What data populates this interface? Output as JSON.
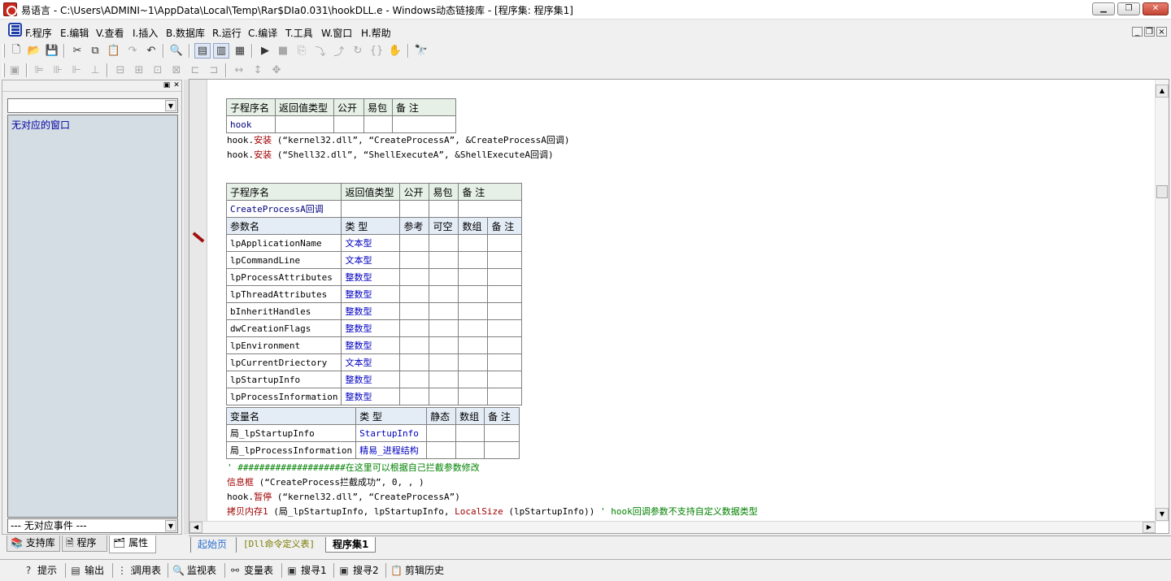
{
  "window": {
    "title": "易语言 - C:\\Users\\ADMINI~1\\AppData\\Local\\Temp\\Rar$DIa0.031\\hookDLL.e - Windows动态链接库 - [程序集: 程序集1]",
    "min": "▁",
    "restore": "❐",
    "close": "✕"
  },
  "menu": [
    "F.程序",
    "E.编辑",
    "V.查看",
    "I.插入",
    "B.数据库",
    "R.运行",
    "C.编译",
    "T.工具",
    "W.窗口",
    "H.帮助"
  ],
  "left_panel": {
    "top_combo": "",
    "list_item": "无对应的窗口",
    "bottom_combo": "--- 无对应事件 ---",
    "tabs": [
      "支持库",
      "程序",
      "属性"
    ]
  },
  "code": {
    "t1": {
      "headers": [
        "子程序名",
        "返回值类型",
        "公开",
        "易包",
        "备 注"
      ],
      "row": [
        "hook",
        "",
        "",
        "",
        ""
      ]
    },
    "line1": {
      "obj": "hook.",
      "fn": "安装",
      "args": " (“kernel32.dll”, “CreateProcessA”, &CreateProcessA回调)"
    },
    "line2": {
      "obj": "hook.",
      "fn": "安装",
      "args": " (“Shell32.dll”, “ShellExecuteA”, &ShellExecuteA回调)"
    },
    "t2": {
      "headers": [
        "子程序名",
        "返回值类型",
        "公开",
        "易包",
        "备 注"
      ],
      "sub_name": "CreateProcessA回调",
      "param_headers": [
        "参数名",
        "类 型",
        "参考",
        "可空",
        "数组",
        "备 注"
      ],
      "params": [
        [
          "lpApplicationName",
          "文本型"
        ],
        [
          "lpCommandLine",
          "文本型"
        ],
        [
          "lpProcessAttributes",
          "整数型"
        ],
        [
          "lpThreadAttributes",
          "整数型"
        ],
        [
          "bInheritHandles",
          "整数型"
        ],
        [
          "dwCreationFlags",
          "整数型"
        ],
        [
          "lpEnvironment",
          "整数型"
        ],
        [
          "lpCurrentDriectory",
          "文本型"
        ],
        [
          "lpStartupInfo",
          "整数型"
        ],
        [
          "lpProcessInformation",
          "整数型"
        ]
      ]
    },
    "t3": {
      "headers": [
        "变量名",
        "类 型",
        "静态",
        "数组",
        "备 注"
      ],
      "vars": [
        [
          "局_lpStartupInfo",
          "StartupInfo"
        ],
        [
          "局_lpProcessInformation",
          "精易_进程结构"
        ]
      ]
    },
    "comment": "' ####################在这里可以根据自己拦截参数修改",
    "line3": {
      "fn": "信息框",
      "args": " (“CreateProcess拦截成功”, 0, , )"
    },
    "line4": {
      "obj": "hook.",
      "fn": "暂停",
      "args": " (“kernel32.dll”, “CreateProcessA”)"
    },
    "line5": {
      "fn": "拷贝内存1",
      "a": " (局_lpStartupInfo, lpStartupInfo, ",
      "fn2": "LocalSize",
      "b": " (lpStartupInfo)) ",
      "cmt": "' hook回调参数不支持自定义数据类型"
    }
  },
  "code_tabs": [
    "起始页",
    "[Dll命令定义表]",
    "程序集1"
  ],
  "bottom_tabs": [
    "提示",
    "输出",
    "调用表",
    "监视表",
    "变量表",
    "搜寻1",
    "搜寻2",
    "剪辑历史"
  ]
}
